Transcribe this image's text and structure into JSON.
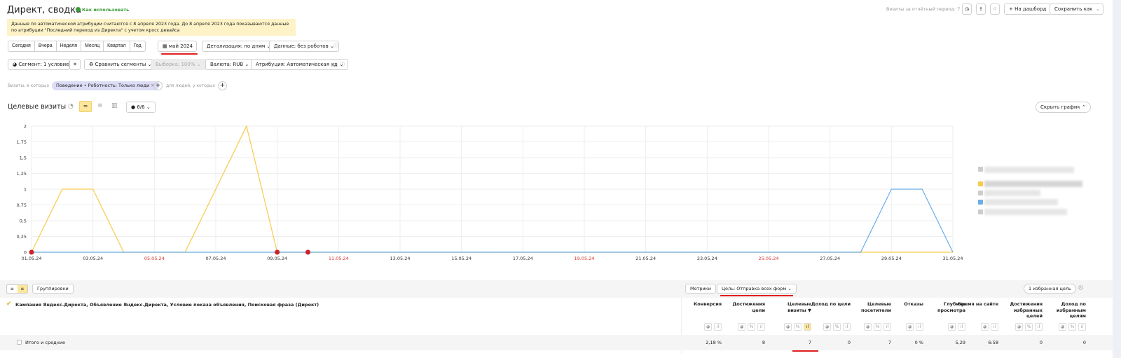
{
  "header": {
    "title": "Директ, сводка",
    "help_link": "Как использовать",
    "visits_label": "Визиты за отчётный период: 7",
    "dashboard_btn": "На дашборд",
    "save_btn": "Сохранить как"
  },
  "notice": "Данные по автоматической атрибуции считаются с 8 апреля 2023 года. До 8 апреля 2023 года показываются данные по атрибуции \"Последний переход из Директа\" с учетом кросс девайса",
  "periods": [
    "Сегодня",
    "Вчера",
    "Неделя",
    "Месяц",
    "Квартал",
    "Год"
  ],
  "date_range": "май 2024",
  "detail": "Детализация: по дням",
  "data_filter": "Данные: без роботов",
  "segment": "Сегмент: 1 условие",
  "compare": "Сравнить сегменты",
  "sample": "Выборка: 100%",
  "currency": "Валюта: RUB",
  "attribution": "Атрибуция: Автоматическая",
  "attribution_badge": "КД",
  "filter": {
    "visits_label": "Визиты, в которых",
    "chip": "Поведение • Роботность: Только люди",
    "people_label": "для людей, у которых"
  },
  "chart_header": {
    "title": "Целевые визиты",
    "series_count": "6/6",
    "hide_btn": "Скрыть график"
  },
  "chart_data": {
    "type": "line",
    "x": [
      "01.05.24",
      "02.05.24",
      "03.05.24",
      "04.05.24",
      "05.05.24",
      "06.05.24",
      "07.05.24",
      "08.05.24",
      "09.05.24",
      "10.05.24",
      "11.05.24",
      "12.05.24",
      "13.05.24",
      "14.05.24",
      "15.05.24",
      "16.05.24",
      "17.05.24",
      "18.05.24",
      "19.05.24",
      "20.05.24",
      "21.05.24",
      "22.05.24",
      "23.05.24",
      "24.05.24",
      "25.05.24",
      "26.05.24",
      "27.05.24",
      "28.05.24",
      "29.05.24",
      "30.05.24",
      "31.05.24"
    ],
    "x_tick_labels": [
      "01.05.24",
      "03.05.24",
      "05.05.24",
      "07.05.24",
      "09.05.24",
      "11.05.24",
      "13.05.24",
      "15.05.24",
      "17.05.24",
      "19.05.24",
      "21.05.24",
      "23.05.24",
      "25.05.24",
      "27.05.24",
      "29.05.24",
      "31.05.24"
    ],
    "weekend_labels": [
      "05.05.24",
      "11.05.24",
      "19.05.24",
      "25.05.24"
    ],
    "y_ticks": [
      "0",
      "0,25",
      "0,5",
      "0,75",
      "1",
      "1,25",
      "1,5",
      "1,75",
      "2"
    ],
    "ylim": [
      0,
      2
    ],
    "grid": true,
    "legend": "right",
    "annotations_at": [
      "01.05.24",
      "09.05.24",
      "10.05.24"
    ],
    "series": [
      {
        "color": "#f9c94a",
        "values": [
          0,
          1,
          1,
          0,
          0,
          0,
          1,
          2,
          0,
          0,
          0,
          0,
          0,
          0,
          0,
          0,
          0,
          0,
          0,
          0,
          0,
          0,
          0,
          0,
          0,
          0,
          0,
          0,
          0,
          0,
          0
        ]
      },
      {
        "color": "#6aaee8",
        "values": [
          0,
          0,
          0,
          0,
          0,
          0,
          0,
          0,
          0,
          0,
          0,
          0,
          0,
          0,
          0,
          0,
          0,
          0,
          0,
          0,
          0,
          0,
          0,
          0,
          0,
          0,
          0,
          0,
          1,
          1,
          0
        ]
      }
    ]
  },
  "table": {
    "groupings_btn": "Группировки",
    "metrics_btn": "Метрики",
    "goal_select": "Цель: Отправка всех форм",
    "fav_goal_btn": "1 избранная цель",
    "dimension_header": "Кампания Яндекс.Директа, Объявление Яндекс.Директа, Условие показа объявления, Поисковая фраза (Директ)",
    "columns": [
      "Конверсия",
      "Достижения цели",
      "Целевые визиты ▼",
      "Доход по цели",
      "Целевые посетители",
      "Отказы",
      "Глубина просмотра",
      "Время на сайте",
      "Достижения избранных целей",
      "Доход по избранным целям"
    ],
    "total_label": "Итого и средние",
    "totals": [
      "2,18 %",
      "8",
      "7",
      "0",
      "7",
      "0 %",
      "5,29",
      "6:58",
      "0",
      "0"
    ]
  }
}
